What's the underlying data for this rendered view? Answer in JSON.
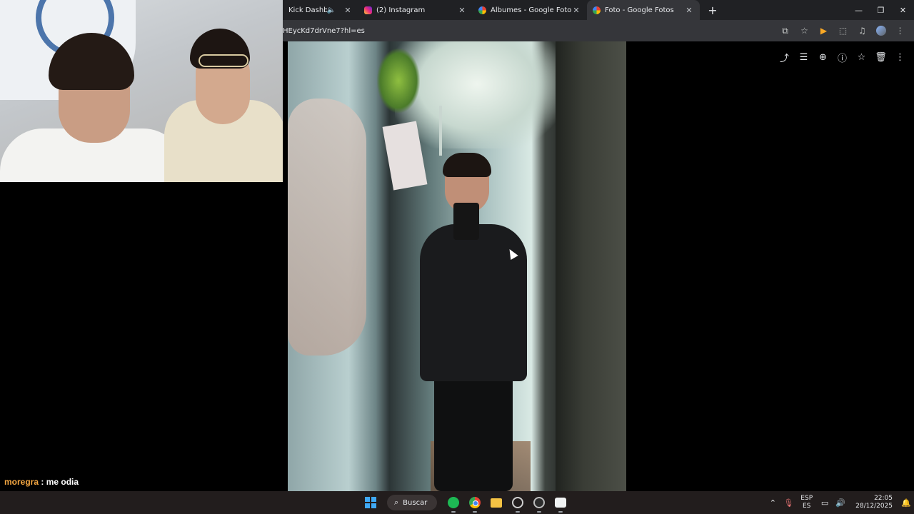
{
  "chrome": {
    "tabs": [
      {
        "label": "Kick Dashboard",
        "favicon": "kick-icon",
        "muted_indicator": "🔈"
      },
      {
        "label": "(2) Instagram",
        "favicon": "instagram-icon"
      },
      {
        "label": "Álbumes - Google Fotos",
        "favicon": "google-photos-icon"
      },
      {
        "label": "Foto - Google Fotos",
        "favicon": "google-photos-icon",
        "active": true
      }
    ],
    "close_glyph": "✕",
    "new_tab_glyph": "+",
    "window": {
      "minimize": "—",
      "restore": "❐",
      "close": "✕"
    },
    "url": "HEycKd7drVne7?hl=es"
  },
  "viewer": {
    "actions": [
      "share-icon",
      "edit-icon",
      "zoom-icon",
      "info-icon",
      "favorite-icon",
      "delete-icon",
      "more-icon"
    ]
  },
  "chat": {
    "user": "moregra",
    "separator": " : ",
    "message": "me odia"
  },
  "taskbar": {
    "search_label": "Buscar",
    "language_line1": "ESP",
    "language_line2": "ES",
    "time": "22:05",
    "date": "28/12/2025"
  },
  "colors": {
    "chrome_dark": "#202124",
    "chrome_toolbar": "#35363a",
    "chat_user": "#f4a742",
    "taskbar": "#221d1d"
  }
}
